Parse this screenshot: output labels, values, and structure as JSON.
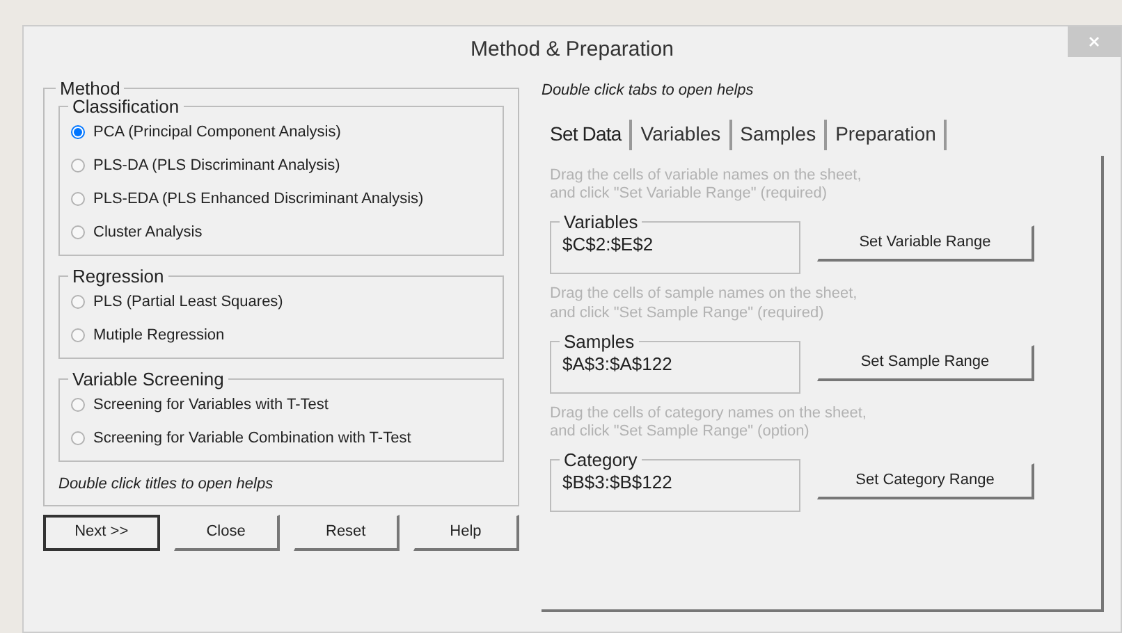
{
  "window": {
    "title": "Method & Preparation"
  },
  "method": {
    "title": "Method",
    "groups": [
      {
        "title": "Classification",
        "options": [
          {
            "label": "PCA (Principal Component Analysis)",
            "selected": true
          },
          {
            "label": "PLS-DA (PLS Discriminant Analysis)",
            "selected": false
          },
          {
            "label": "PLS-EDA (PLS Enhanced Discriminant Analysis)",
            "selected": false
          },
          {
            "label": "Cluster Analysis",
            "selected": false
          }
        ]
      },
      {
        "title": "Regression",
        "options": [
          {
            "label": "PLS (Partial Least Squares)",
            "selected": false
          },
          {
            "label": "Mutiple Regression",
            "selected": false
          }
        ]
      },
      {
        "title": "Variable Screening",
        "options": [
          {
            "label": "Screening for Variables with T-Test",
            "selected": false
          },
          {
            "label": "Screening for Variable Combination with T-Test",
            "selected": false
          }
        ]
      }
    ],
    "hint": "Double click titles to open helps"
  },
  "buttons": [
    {
      "label": "Next >>",
      "default": true
    },
    {
      "label": "Close",
      "default": false
    },
    {
      "label": "Reset",
      "default": false
    },
    {
      "label": "Help",
      "default": false
    }
  ],
  "data": {
    "hint": "Double click tabs to open helps",
    "tabs": [
      {
        "label": "Set Data",
        "selected": true
      },
      {
        "label": "Variables",
        "selected": false
      },
      {
        "label": "Samples",
        "selected": false
      },
      {
        "label": "Preparation",
        "selected": false
      }
    ],
    "ranges": [
      {
        "instruction": "Drag the cells of variable names on the sheet,\nand click \"Set Variable Range\" (required)",
        "title": "Variables",
        "value": "$C$2:$E$2",
        "button": "Set Variable Range"
      },
      {
        "instruction": "Drag the cells of sample names on the sheet,\nand click \"Set Sample Range\" (required)",
        "title": "Samples",
        "value": "$A$3:$A$122",
        "button": "Set Sample Range"
      },
      {
        "instruction": "Drag the cells of category names on the sheet,\nand click \"Set Sample Range\" (option)",
        "title": "Category",
        "value": "$B$3:$B$122",
        "button": "Set Category Range"
      }
    ]
  }
}
